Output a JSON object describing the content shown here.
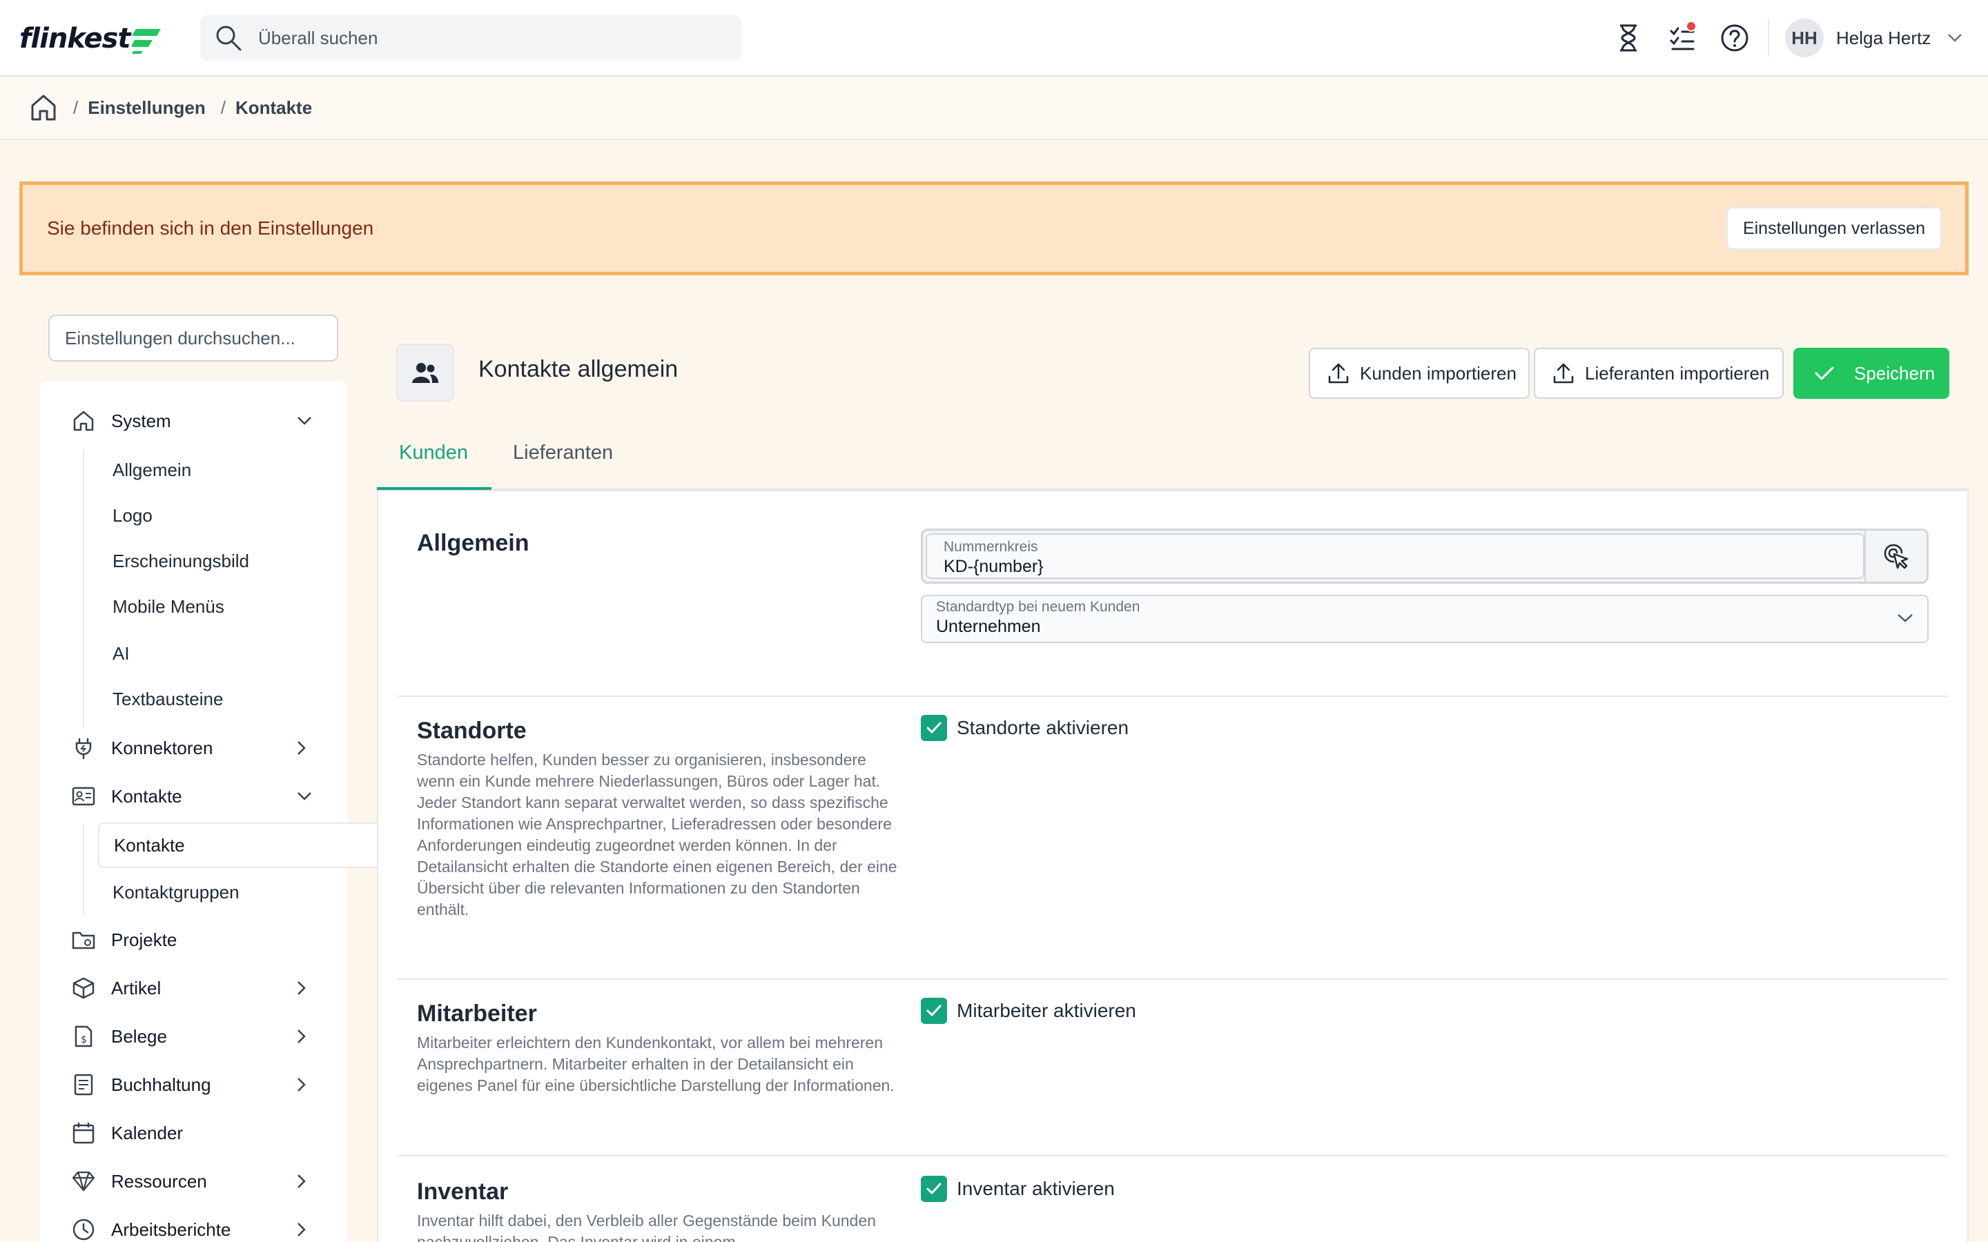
{
  "app": {
    "logo_text": "flinkest"
  },
  "topbar": {
    "search_placeholder": "Überall suchen",
    "icons": [
      "hourglass-icon",
      "tasks-icon",
      "help-icon"
    ],
    "user": {
      "initials": "HH",
      "name": "Helga Hertz"
    }
  },
  "breadcrumb": {
    "items": [
      "Einstellungen",
      "Kontakte"
    ]
  },
  "notice": {
    "text": "Sie befinden sich in den Einstellungen",
    "button": "Einstellungen verlassen"
  },
  "sidebar": {
    "search_placeholder": "Einstellungen durchsuchen...",
    "items": [
      {
        "label": "System",
        "icon": "home-icon",
        "state": "expanded"
      },
      {
        "label": "Konnektoren",
        "icon": "plug-icon",
        "state": "collapsed"
      },
      {
        "label": "Kontakte",
        "icon": "contact-card-icon",
        "state": "expanded"
      },
      {
        "label": "Projekte",
        "icon": "folder-icon",
        "state": "none"
      },
      {
        "label": "Artikel",
        "icon": "box-icon",
        "state": "collapsed"
      },
      {
        "label": "Belege",
        "icon": "receipt-icon",
        "state": "collapsed"
      },
      {
        "label": "Buchhaltung",
        "icon": "ledger-icon",
        "state": "collapsed"
      },
      {
        "label": "Kalender",
        "icon": "calendar-icon",
        "state": "none"
      },
      {
        "label": "Ressourcen",
        "icon": "diamond-icon",
        "state": "collapsed"
      },
      {
        "label": "Arbeitsberichte",
        "icon": "clock-icon",
        "state": "collapsed"
      }
    ],
    "system_sub": [
      "Allgemein",
      "Logo",
      "Erscheinungsbild",
      "Mobile Menüs",
      "AI",
      "Textbausteine"
    ],
    "kontakte_sub": [
      "Kontakte",
      "Kontaktgruppen"
    ],
    "active_sub": "Kontakte"
  },
  "header": {
    "title": "Kontakte allgemein",
    "import_customers": "Kunden importieren",
    "import_suppliers": "Lieferanten importieren",
    "save": "Speichern"
  },
  "tabs": [
    "Kunden",
    "Lieferanten"
  ],
  "sections": {
    "allgemein": {
      "title": "Allgemein",
      "number_field": {
        "label": "Nummernkreis",
        "value": "KD-{number}"
      },
      "type_field": {
        "label": "Standardtyp bei neuem Kunden",
        "value": "Unternehmen"
      }
    },
    "standorte": {
      "title": "Standorte",
      "desc": "Standorte helfen, Kunden besser zu organisieren, insbesondere wenn ein Kunde mehrere Niederlassungen, Büros oder Lager hat. Jeder Standort kann separat verwaltet werden, so dass spezifische Informationen wie Ansprechpartner, Lieferadressen oder besondere Anforderungen eindeutig zugeordnet werden können. In der Detailansicht erhalten die Standorte einen eigenen Bereich, der eine Übersicht über die relevanten Informationen zu den Standorten enthält.",
      "checkbox": "Standorte aktivieren",
      "checked": true
    },
    "mitarbeiter": {
      "title": "Mitarbeiter",
      "desc": "Mitarbeiter erleichtern den Kundenkontakt, vor allem bei mehreren Ansprechpartnern. Mitarbeiter erhalten in der Detailansicht ein eigenes Panel für eine übersichtliche Darstellung der Informationen.",
      "checkbox": "Mitarbeiter aktivieren",
      "checked": true
    },
    "inventar": {
      "title": "Inventar",
      "desc": "Inventar hilft dabei, den Verbleib aller Gegenstände beim Kunden nachzuvollziehen. Das Inventar wird in einem",
      "checkbox": "Inventar aktivieren",
      "checked": true
    }
  },
  "colors": {
    "accent": "#16a37f",
    "save": "#22c55e",
    "notice_bg": "#fee4c8",
    "notice_border": "#f5b160",
    "page_bg": "#fdf6ec"
  }
}
